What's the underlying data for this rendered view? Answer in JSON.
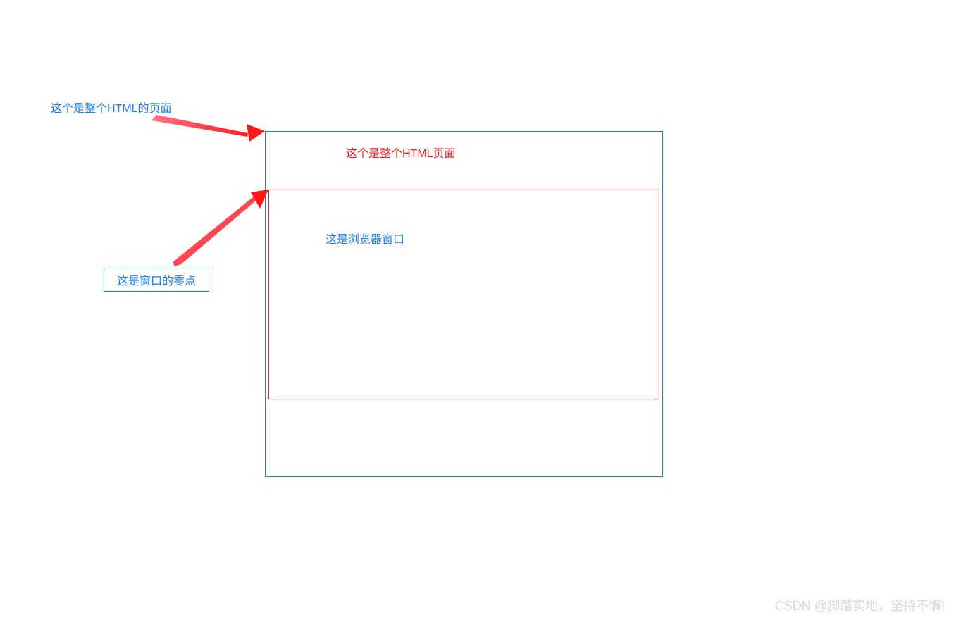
{
  "labels": {
    "top_label": "这个是整个HTML的页面",
    "outer_box_title": "这个是整个HTML页面",
    "inner_box_title": "这是浏览器窗口",
    "zero_point": "这是窗口的零点"
  },
  "watermark": "CSDN @脚踏实地，坚持不懈!",
  "colors": {
    "blue": "#1b7bff",
    "red": "#ff1a1a",
    "watermark_gray": "#d6d6d6"
  }
}
